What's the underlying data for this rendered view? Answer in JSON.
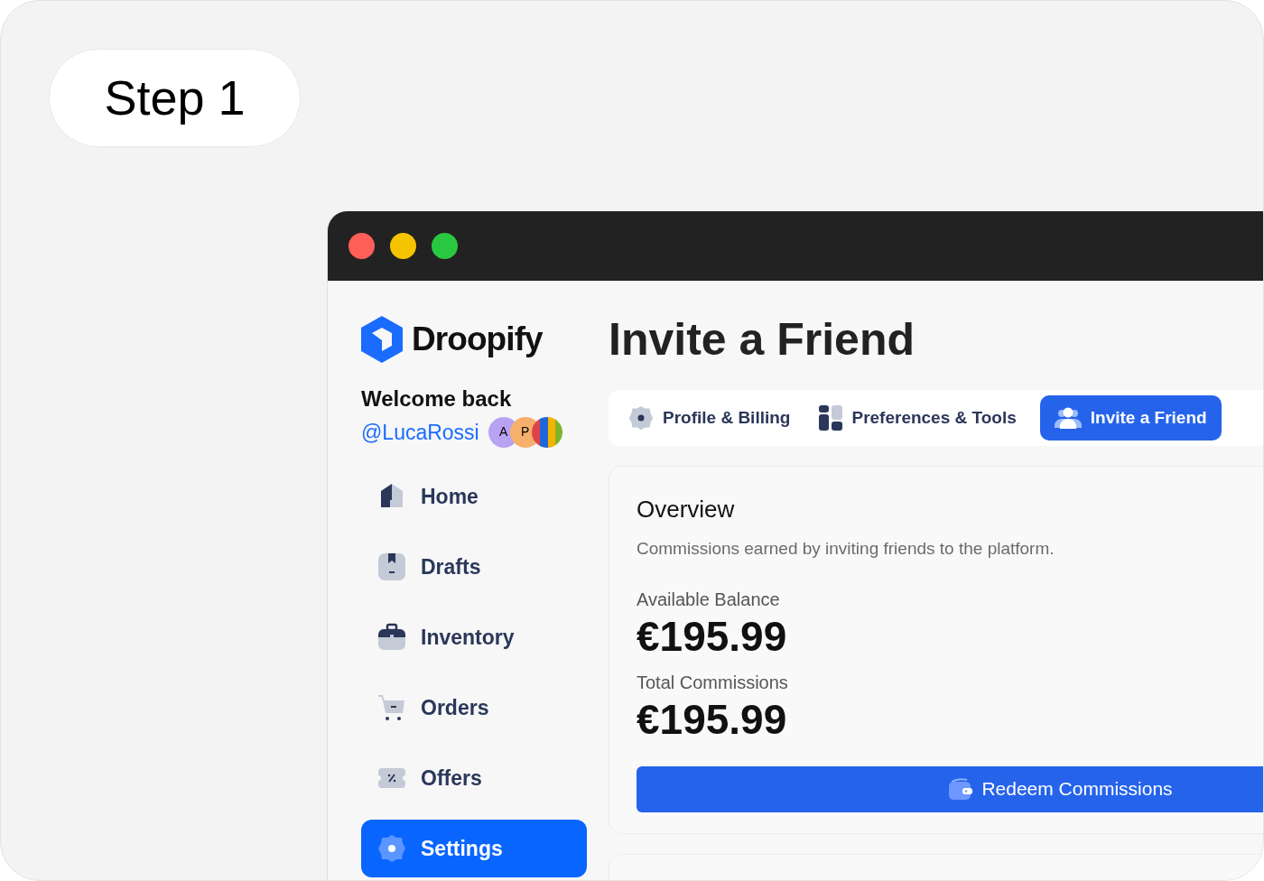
{
  "step_badge": "Step 1",
  "window": {
    "controls": [
      {
        "color": "#fe5f57"
      },
      {
        "color": "#f5c400"
      },
      {
        "color": "#2ac840"
      }
    ]
  },
  "sidebar": {
    "brand": "Droopify",
    "welcome": "Welcome back",
    "handle": "@LucaRossi",
    "avatars": [
      {
        "kind": "initial",
        "text": "A",
        "color": "#b8a2f2"
      },
      {
        "kind": "initial",
        "text": "P",
        "color": "#f6b06c"
      },
      {
        "kind": "picture"
      }
    ],
    "items": [
      {
        "label": "Home",
        "selected": false
      },
      {
        "label": "Drafts",
        "selected": false
      },
      {
        "label": "Inventory",
        "selected": false
      },
      {
        "label": "Orders",
        "selected": false
      },
      {
        "label": "Offers",
        "selected": false
      },
      {
        "label": "Settings",
        "selected": true
      }
    ]
  },
  "page_title": "Invite a Friend",
  "tabs": [
    {
      "label": "Profile & Billing",
      "selected": false
    },
    {
      "label": "Preferences & Tools",
      "selected": false
    },
    {
      "label": "Invite a Friend",
      "selected": true
    }
  ],
  "overview": {
    "title": "Overview",
    "description": "Commissions earned by inviting friends to the platform.",
    "balances": [
      {
        "label": "Available Balance",
        "amount": "€195.99"
      },
      {
        "label": "Total Commissions",
        "amount": "€195.99"
      }
    ],
    "redeem_button": "Redeem Commissions"
  }
}
